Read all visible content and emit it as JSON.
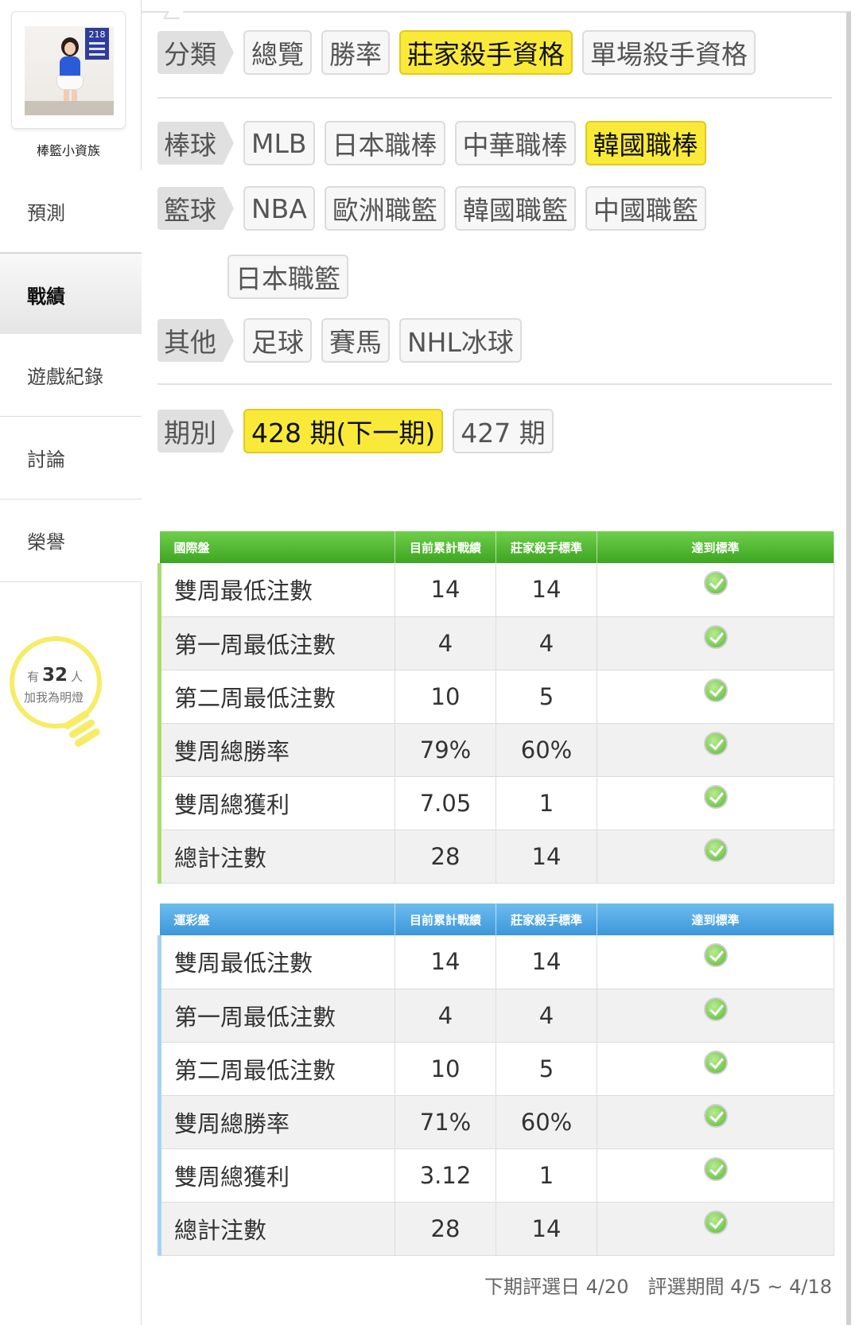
{
  "profile": {
    "name": "棒籃小資族",
    "avatar_badge": "218"
  },
  "nav": [
    {
      "label": "預測",
      "active": false
    },
    {
      "label": "戰績",
      "active": true
    },
    {
      "label": "遊戲紀錄",
      "active": false
    },
    {
      "label": "討論",
      "active": false
    },
    {
      "label": "榮譽",
      "active": false
    }
  ],
  "lamp": {
    "prefix": "有",
    "count": "32",
    "suffix": "人",
    "text": "加我為明燈"
  },
  "filters": {
    "category": {
      "label": "分類",
      "options": [
        "總覽",
        "勝率",
        "莊家殺手資格",
        "單場殺手資格"
      ],
      "selected": "莊家殺手資格"
    },
    "baseball": {
      "label": "棒球",
      "options": [
        "MLB",
        "日本職棒",
        "中華職棒",
        "韓國職棒"
      ],
      "selected": "韓國職棒"
    },
    "basketball": {
      "label": "籃球",
      "options": [
        "NBA",
        "歐洲職籃",
        "韓國職籃",
        "中國職籃",
        "日本職籃"
      ]
    },
    "other": {
      "label": "其他",
      "options": [
        "足球",
        "賽馬",
        "NHL冰球"
      ]
    },
    "period": {
      "label": "期別",
      "options": [
        "428 期(下一期)",
        "427 期"
      ],
      "selected": "428 期(下一期)"
    }
  },
  "tables": {
    "columns": [
      "目前累計戰績",
      "莊家殺手標準",
      "達到標準"
    ],
    "international": {
      "title": "國際盤",
      "rows": [
        {
          "name": "雙周最低注數",
          "current": "14",
          "standard": "14",
          "met": true
        },
        {
          "name": "第一周最低注數",
          "current": "4",
          "standard": "4",
          "met": true
        },
        {
          "name": "第二周最低注數",
          "current": "10",
          "standard": "5",
          "met": true
        },
        {
          "name": "雙周總勝率",
          "current": "79%",
          "standard": "60%",
          "met": true
        },
        {
          "name": "雙周總獲利",
          "current": "7.05",
          "standard": "1",
          "met": true
        },
        {
          "name": "總計注數",
          "current": "28",
          "standard": "14",
          "met": true
        }
      ]
    },
    "sports_lottery": {
      "title": "運彩盤",
      "rows": [
        {
          "name": "雙周最低注數",
          "current": "14",
          "standard": "14",
          "met": true
        },
        {
          "name": "第一周最低注數",
          "current": "4",
          "standard": "4",
          "met": true
        },
        {
          "name": "第二周最低注數",
          "current": "10",
          "standard": "5",
          "met": true
        },
        {
          "name": "雙周總勝率",
          "current": "71%",
          "standard": "60%",
          "met": true
        },
        {
          "name": "雙周總獲利",
          "current": "3.12",
          "standard": "1",
          "met": true
        },
        {
          "name": "總計注數",
          "current": "28",
          "standard": "14",
          "met": true
        }
      ]
    }
  },
  "footer": {
    "next_selection": "下期評選日 4/20",
    "selection_period": "評選期間 4/5 ~ 4/18"
  },
  "colors": {
    "selected": "#f9ea3a",
    "green_header": "#3da521",
    "blue_header": "#3c97d9",
    "lamp": "#f7ec66"
  }
}
